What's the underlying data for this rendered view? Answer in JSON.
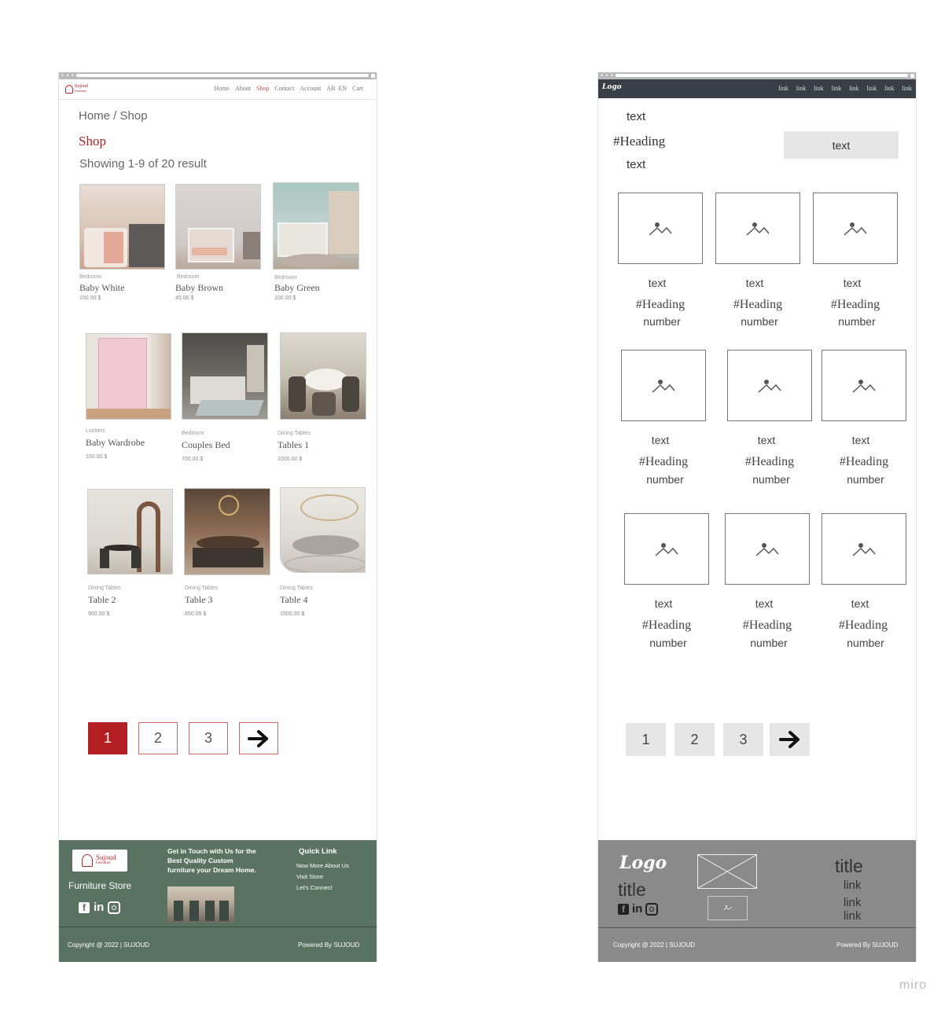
{
  "left": {
    "nav": {
      "brand_line1": "Sujoud",
      "brand_line2": "Furniture",
      "links": [
        "Home",
        "About",
        "Shop",
        "Contact",
        "Account",
        "AR",
        "EN",
        "Cart"
      ]
    },
    "breadcrumb": "Home / Shop",
    "page_title": "Shop",
    "result_count": "Showing 1-9 of 20 result",
    "products": [
      {
        "category": "Bedroom",
        "name": "Baby White",
        "price": "150.00 $"
      },
      {
        "category": "Bedroom",
        "name": "Baby Brown",
        "price": "45.00 $"
      },
      {
        "category": "Bedroom",
        "name": "Baby Green",
        "price": "100.00 $"
      },
      {
        "category": "Lockers",
        "name": "Baby Wardrobe",
        "price": "100.00 $"
      },
      {
        "category": "Bedroom",
        "name": "Couples Bed",
        "price": "700.00 $"
      },
      {
        "category": "Dining Tables",
        "name": "Tables 1",
        "price": "1000.00 $"
      },
      {
        "category": "Dining Tables",
        "name": "Table 2",
        "price": "900.00 $"
      },
      {
        "category": "Dining Tables",
        "name": "Table 3",
        "price": "850.00 $"
      },
      {
        "category": "Dining Tables",
        "name": "Table 4",
        "price": "1500.00 $"
      }
    ],
    "pagination": [
      "1",
      "2",
      "3"
    ],
    "footer": {
      "logo_line1": "Sujoud",
      "logo_line2": "Furniture",
      "store_title": "Furniture Store",
      "cta": "Get in Touch with Us for the Best Quality Custom furniture your Dream Home.",
      "quick_link_title": "Quick Link",
      "quick_links": [
        "Now More About Us",
        "Visit Store",
        "Let's Connect"
      ],
      "copyright": "Copyright @ 2022 | SUJOUD",
      "powered": "Powered By SUJOUD"
    }
  },
  "right": {
    "nav": {
      "logo": "Logo",
      "links": [
        "link",
        "link",
        "link",
        "link",
        "link",
        "link",
        "link",
        "link"
      ]
    },
    "top_text": "text",
    "heading": "#Heading",
    "sub_text": "text",
    "button_text": "text",
    "cards": [
      {
        "text": "text",
        "heading": "#Heading",
        "number": "number"
      },
      {
        "text": "text",
        "heading": "#Heading",
        "number": "number"
      },
      {
        "text": "text",
        "heading": "#Heading",
        "number": "number"
      },
      {
        "text": "text",
        "heading": "#Heading",
        "number": "number"
      },
      {
        "text": "text",
        "heading": "#Heading",
        "number": "number"
      },
      {
        "text": "text",
        "heading": "#Heading",
        "number": "number"
      },
      {
        "text": "text",
        "heading": "#Heading",
        "number": "number"
      },
      {
        "text": "text",
        "heading": "#Heading",
        "number": "number"
      },
      {
        "text": "text",
        "heading": "#Heading",
        "number": "number"
      }
    ],
    "pagination": [
      "1",
      "2",
      "3"
    ],
    "footer": {
      "logo": "Logo",
      "title_left": "title",
      "title_right": "title",
      "links": [
        "link",
        "link",
        "link"
      ],
      "copyright": "Copyright @ 2022 | SUJOUD",
      "powered": "Powered By SUJOUD"
    }
  },
  "watermark": "miro",
  "colors": {
    "accent": "#b21e22",
    "footer_green": "#5a7261",
    "wire_footer": "#8a8a8a",
    "wire_nav": "#3a3f47"
  }
}
